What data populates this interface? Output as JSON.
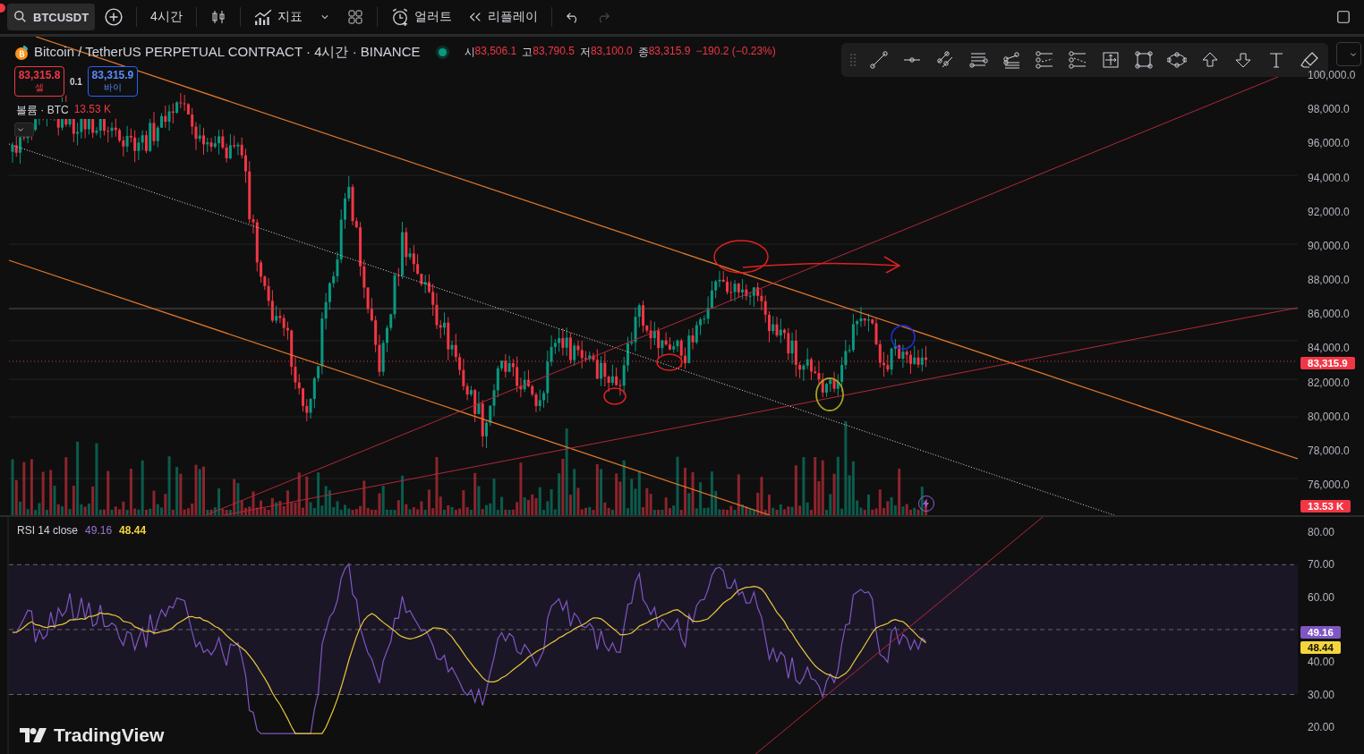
{
  "toolbar": {
    "symbol": "BTCUSDT",
    "interval": "4시간",
    "indicators": "지표",
    "alert": "얼러트",
    "replay": "리플레이",
    "undo": {
      "disabled": false
    },
    "redo": {
      "disabled": true
    }
  },
  "legend": {
    "title": "Bitcoin / TetherUS PERPETUAL CONTRACT · 4시간 · BINANCE",
    "market_open": true,
    "ohlc": [
      {
        "label": "시",
        "value": "83,506.1"
      },
      {
        "label": "고",
        "value": "83,790.5"
      },
      {
        "label": "저",
        "value": "83,100.0"
      },
      {
        "label": "종",
        "value": "83,315.9"
      }
    ],
    "change": "−190.2 (−0.23%)",
    "sell": {
      "price": "83,315.8",
      "label": "셀"
    },
    "quantity": "0.1",
    "buy": {
      "price": "83,315.9",
      "label": "바이"
    },
    "volume": {
      "label": "볼륨 · BTC",
      "value": "13.53 K"
    }
  },
  "price_axis": {
    "ticks": [
      "100,000.0",
      "98,000.0",
      "96,000.0",
      "94,000.0",
      "92,000.0",
      "90,000.0",
      "88,000.0",
      "86,000.0",
      "84,000.0",
      "82,000.0",
      "80,000.0",
      "78,000.0",
      "76,000.0"
    ],
    "last_price": "83,315.9",
    "volume_badge": "13.53 K"
  },
  "rsi": {
    "label": "RSI 14 close",
    "value": "49.16",
    "ma_value": "48.44",
    "ticks": [
      "80.00",
      "70.00",
      "60.00",
      "40.00",
      "30.00",
      "20.00"
    ],
    "value_badge": "49.16",
    "ma_badge": "48.44"
  },
  "branding": "TradingView"
}
